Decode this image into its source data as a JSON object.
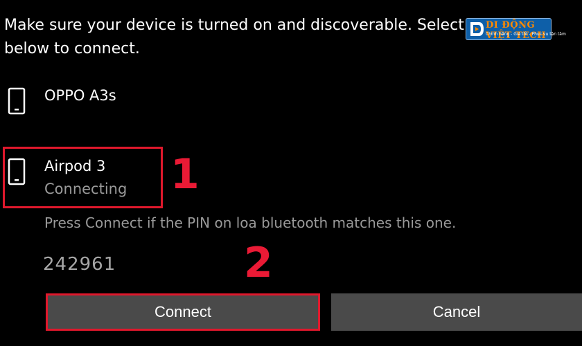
{
  "intro_text": "Make sure your device is turned on and discoverable. Select a device below to connect.",
  "logo": {
    "name": "DI DONG VIET TECH",
    "tagline": "Chinh hang - Gia tot - Phuc vu tan tam",
    "text_is_image": true
  },
  "devices": [
    {
      "name": "OPPO A3s",
      "status": "",
      "icon": "phone-icon"
    },
    {
      "name": "Airpod 3",
      "status": "Connecting",
      "icon": "phone-icon"
    }
  ],
  "annotations": {
    "step1": "1",
    "step2": "2"
  },
  "pin_hint": "Press Connect if the PIN on loa bluetooth matches this one.",
  "pin": "242961",
  "buttons": {
    "connect": "Connect",
    "cancel": "Cancel"
  },
  "colors": {
    "background": "#000000",
    "button": "#4a4a4a",
    "highlight": "#e0182c",
    "step_number": "#ea1a35",
    "secondary_text": "#9a9a9a"
  }
}
